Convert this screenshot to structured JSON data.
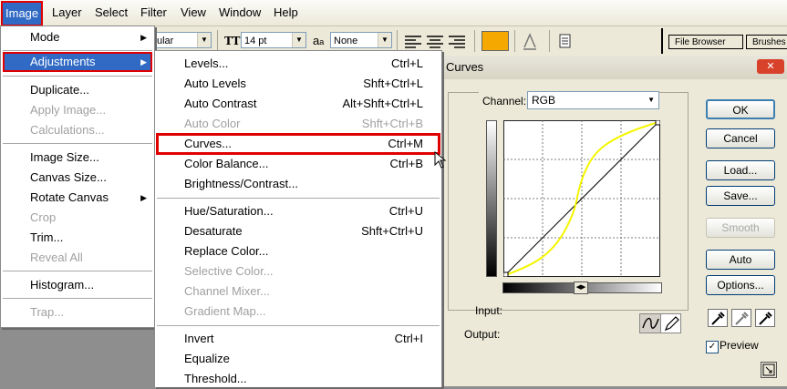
{
  "menubar": {
    "items": [
      "Image",
      "Layer",
      "Select",
      "Filter",
      "View",
      "Window",
      "Help"
    ]
  },
  "toolbar": {
    "style_value": "ular",
    "font_icon": "TT",
    "size_value": "14 pt",
    "aa_label": "a",
    "aa_sub": "a",
    "antialias_value": "None",
    "swatch_color": "#f5a800",
    "tabs": [
      "File Browser",
      "Brushes"
    ]
  },
  "image_menu": {
    "items": [
      {
        "label": "Mode"
      },
      {
        "label": "Adjustments"
      },
      {
        "label": "Duplicate..."
      },
      {
        "label": "Apply Image..."
      },
      {
        "label": "Calculations..."
      },
      {
        "label": "Image Size..."
      },
      {
        "label": "Canvas Size..."
      },
      {
        "label": "Rotate Canvas"
      },
      {
        "label": "Crop"
      },
      {
        "label": "Trim..."
      },
      {
        "label": "Reveal All"
      },
      {
        "label": "Histogram..."
      },
      {
        "label": "Trap..."
      }
    ]
  },
  "adjust_menu": {
    "items": [
      {
        "label": "Levels...",
        "shortcut": "Ctrl+L"
      },
      {
        "label": "Auto Levels",
        "shortcut": "Shft+Ctrl+L"
      },
      {
        "label": "Auto Contrast",
        "shortcut": "Alt+Shft+Ctrl+L"
      },
      {
        "label": "Auto Color",
        "shortcut": "Shft+Ctrl+B"
      },
      {
        "label": "Curves...",
        "shortcut": "Ctrl+M"
      },
      {
        "label": "Color Balance...",
        "shortcut": "Ctrl+B"
      },
      {
        "label": "Brightness/Contrast..."
      },
      {
        "label": "Hue/Saturation...",
        "shortcut": "Ctrl+U"
      },
      {
        "label": "Desaturate",
        "shortcut": "Shft+Ctrl+U"
      },
      {
        "label": "Replace Color..."
      },
      {
        "label": "Selective Color..."
      },
      {
        "label": "Channel Mixer..."
      },
      {
        "label": "Gradient Map..."
      },
      {
        "label": "Invert",
        "shortcut": "Ctrl+I"
      },
      {
        "label": "Equalize"
      },
      {
        "label": "Threshold..."
      }
    ]
  },
  "curves_dialog": {
    "title": "Curves",
    "close_glyph": "✕",
    "channel_label": "Channel:",
    "channel_value": "RGB",
    "input_label": "Input:",
    "output_label": "Output:",
    "preview_label": "Preview",
    "preview_checked": true,
    "curve_color": "#f5f500",
    "buttons": {
      "ok": "OK",
      "cancel": "Cancel",
      "load": "Load...",
      "save": "Save...",
      "smooth": "Smooth",
      "auto": "Auto",
      "options": "Options..."
    }
  },
  "colors": {
    "accent_red": "#e00000",
    "menu_highlight": "#316ac5"
  }
}
